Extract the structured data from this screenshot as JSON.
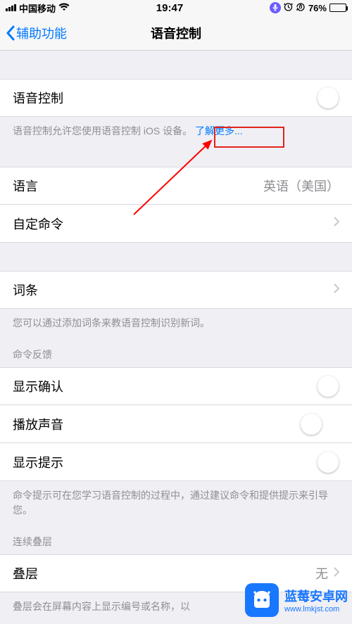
{
  "statusbar": {
    "carrier": "中国移动",
    "time": "19:47",
    "battery_pct": "76%"
  },
  "nav": {
    "back_label": "辅助功能",
    "title": "语音控制"
  },
  "main_switch": {
    "label": "语音控制",
    "on": true,
    "footer_pre": "语音控制允许您使用语音控制 iOS 设备。",
    "footer_link": "了解更多..."
  },
  "rows": {
    "language": {
      "label": "语言",
      "value": "英语（美国）"
    },
    "custom_commands": {
      "label": "自定命令"
    },
    "vocabulary": {
      "label": "词条"
    },
    "vocab_footer": "您可以通过添加词条来教语音控制识别新词。"
  },
  "feedback": {
    "header": "命令反馈",
    "show_confirmation": {
      "label": "显示确认",
      "on": true
    },
    "play_sound": {
      "label": "播放声音",
      "on": false
    },
    "show_hints": {
      "label": "显示提示",
      "on": true
    },
    "footer": "命令提示可在您学习语音控制的过程中，通过建议命令和提供提示来引导您。"
  },
  "overlay": {
    "header": "连续叠层",
    "row_label": "叠层",
    "row_value": "无",
    "footer": "叠层会在屏幕内容上显示编号或名称，以"
  },
  "watermark": {
    "name": "蓝莓安卓网",
    "url": "www.lmkjst.com"
  },
  "annotation": {
    "highlight_color": "#e2231a",
    "arrow_color": "#ff0000"
  }
}
